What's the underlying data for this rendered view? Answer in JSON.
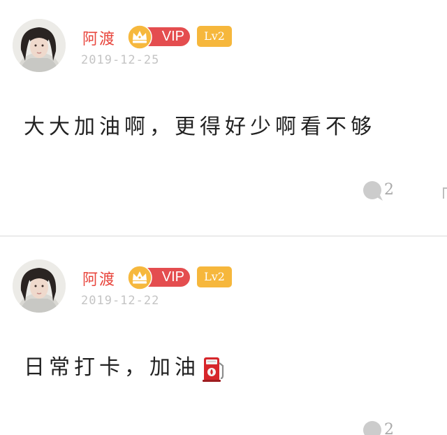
{
  "comments": [
    {
      "username": "阿渡",
      "vip_label": "VIP",
      "level": "Lv2",
      "timestamp": "2019-12-25",
      "text": "大大加油啊，更得好少啊看不够",
      "reply_count": "2"
    },
    {
      "username": "阿渡",
      "vip_label": "VIP",
      "level": "Lv2",
      "timestamp": "2019-12-22",
      "text": "日常打卡，加油",
      "emoji": "fuel-pump",
      "reply_count": "2"
    }
  ],
  "colors": {
    "username": "#e8453c",
    "vip_pill": "#e44d4f",
    "crown_coin": "#f6b83d",
    "level_badge": "#f6b73c",
    "timestamp": "#c4c4c4",
    "reply_icon": "#cccccc"
  },
  "icons": {
    "crown": "crown-icon",
    "reply": "speech-bubble-icon",
    "emoji": "fuel-pump-icon"
  }
}
